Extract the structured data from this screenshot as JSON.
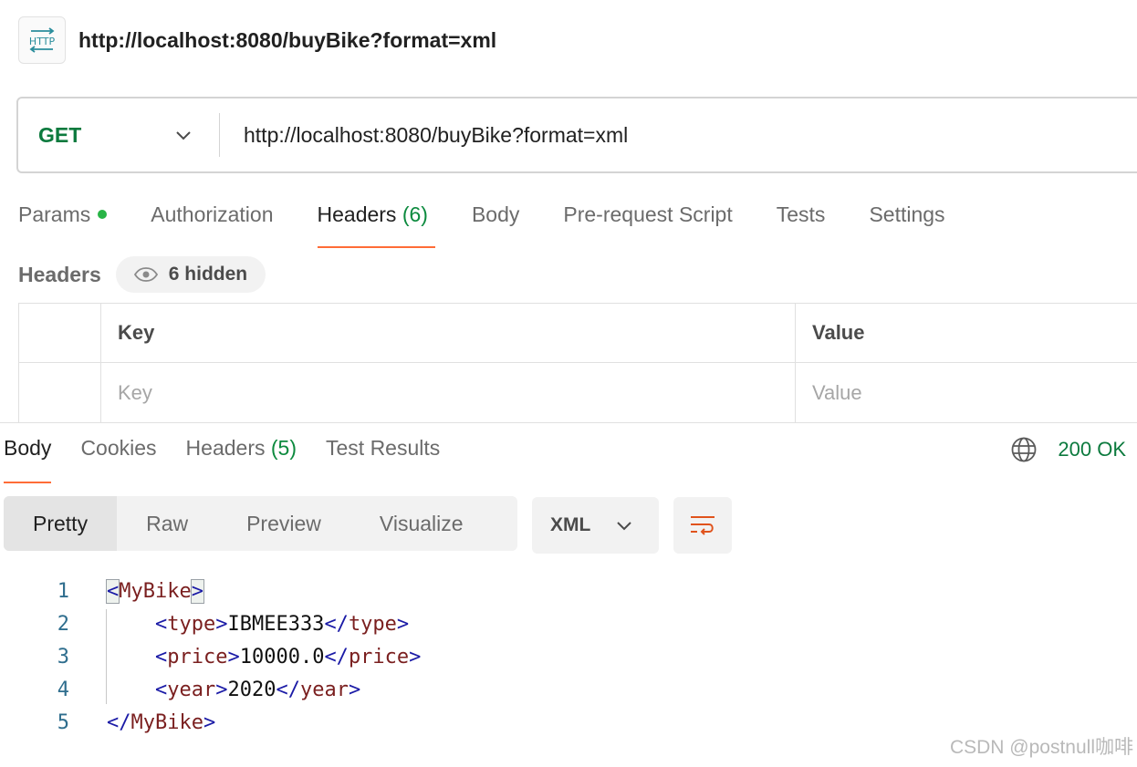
{
  "title": {
    "icon": "http-icon",
    "text": "http://localhost:8080/buyBike?format=xml"
  },
  "request": {
    "method": "GET",
    "url": "http://localhost:8080/buyBike?format=xml",
    "tabs": [
      {
        "label": "Params",
        "dot": true
      },
      {
        "label": "Authorization"
      },
      {
        "label": "Headers",
        "count": "(6)",
        "active": true
      },
      {
        "label": "Body"
      },
      {
        "label": "Pre-request Script"
      },
      {
        "label": "Tests"
      },
      {
        "label": "Settings"
      }
    ],
    "headers_label": "Headers",
    "hidden_label": "6 hidden",
    "table": {
      "col_key": "Key",
      "col_value": "Value",
      "placeholder_key": "Key",
      "placeholder_value": "Value"
    }
  },
  "response": {
    "tabs": [
      {
        "label": "Body",
        "active": true
      },
      {
        "label": "Cookies"
      },
      {
        "label": "Headers",
        "count": "(5)"
      },
      {
        "label": "Test Results"
      }
    ],
    "status": "200 OK",
    "views": [
      "Pretty",
      "Raw",
      "Preview",
      "Visualize"
    ],
    "language": "XML",
    "code": [
      {
        "n": "1",
        "indent": "",
        "open": "MyBike",
        "text": "",
        "close": ""
      },
      {
        "n": "2",
        "indent": "    ",
        "open": "type",
        "text": "IBMEE333",
        "close": "type"
      },
      {
        "n": "3",
        "indent": "    ",
        "open": "price",
        "text": "10000.0",
        "close": "price"
      },
      {
        "n": "4",
        "indent": "    ",
        "open": "year",
        "text": "2020",
        "close": "year"
      },
      {
        "n": "5",
        "indent": "",
        "open": "",
        "text": "",
        "close": "MyBike"
      }
    ]
  },
  "watermark": "CSDN @postnull咖啡",
  "colors": {
    "accent": "#ff6c37",
    "success": "#0c7a3e",
    "dot": "#28b446"
  }
}
